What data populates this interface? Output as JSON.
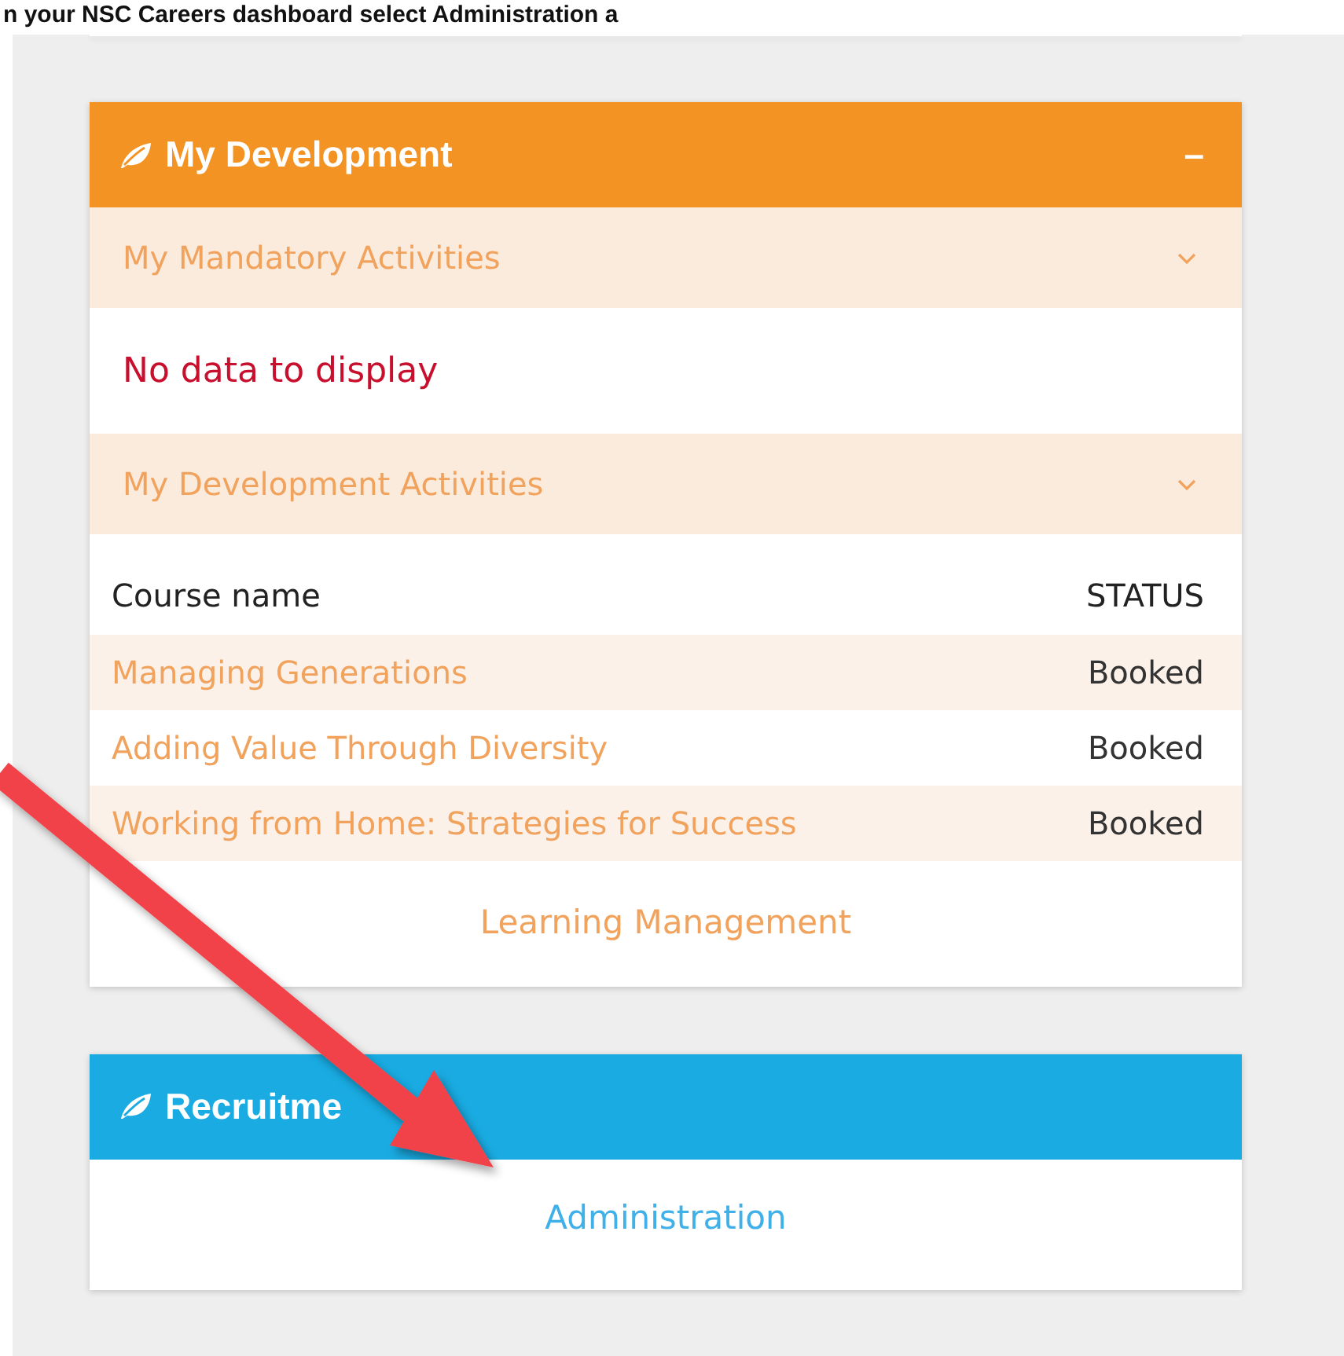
{
  "instruction": "n your NSC Careers dashboard select Administration a",
  "development": {
    "title": "My Development",
    "collapse_symbol": "–",
    "sections": [
      {
        "kind": "message",
        "title": "My Mandatory Activities",
        "expanded": true,
        "message": "No data to display"
      },
      {
        "kind": "table",
        "title": "My Development Activities",
        "expanded": true,
        "columns": [
          "Course name",
          "STATUS"
        ],
        "rows": [
          {
            "course": "Managing Generations",
            "status": "Booked"
          },
          {
            "course": "Adding Value Through Diversity",
            "status": "Booked"
          },
          {
            "course": "Working from Home: Strategies for Success",
            "status": "Booked"
          }
        ]
      }
    ],
    "footer_link": "Learning Management"
  },
  "recruitment": {
    "title": "Recruitme",
    "link": "Administration"
  }
}
